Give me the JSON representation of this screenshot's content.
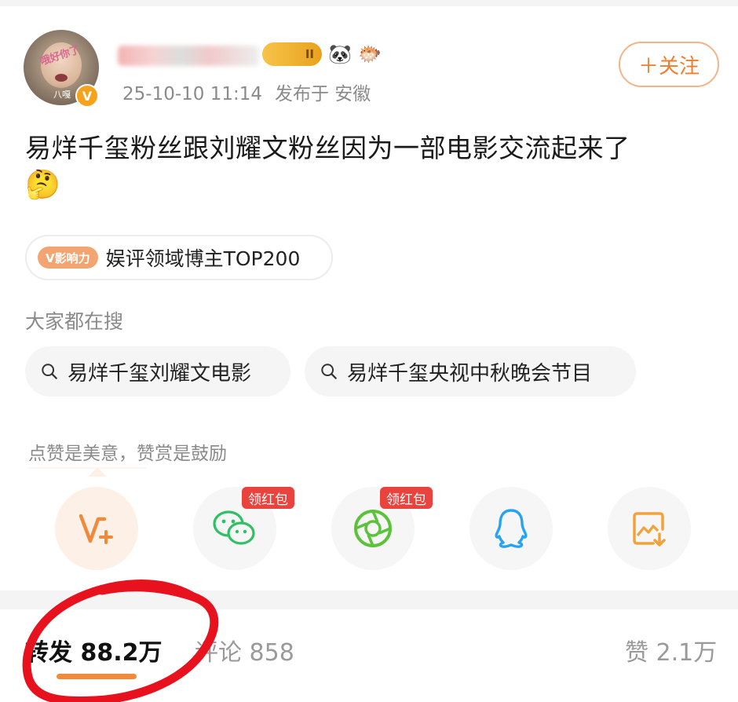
{
  "header": {
    "avatar_caption": "八嘎",
    "avatar_sticker": "哦好你了",
    "verified_mark": "V",
    "level_badge": "II",
    "timestamp": "25-10-10 11:14",
    "location": "发布于 安徽",
    "follow_label": "＋关注"
  },
  "post": {
    "text": "易烊千玺粉丝跟刘耀文粉丝因为一部电影交流起来了",
    "emoji": "🤔",
    "influence_tag": "V影响力",
    "influence_text": "娱评领域博主TOP200"
  },
  "searches": {
    "title": "大家都在搜",
    "items": [
      {
        "label": "易烊千玺刘耀文电影"
      },
      {
        "label": "易烊千玺央视中秋晚会节目"
      }
    ]
  },
  "reward": {
    "text": "点赞是美意，赞赏是鼓励"
  },
  "share": {
    "items": [
      {
        "icon": "weibo-reward-icon"
      },
      {
        "icon": "wechat-icon",
        "badge": "领红包"
      },
      {
        "icon": "moments-icon",
        "badge": "领红包"
      },
      {
        "icon": "qq-icon"
      },
      {
        "icon": "save-image-icon"
      }
    ]
  },
  "tabs": {
    "repost": "转发 88.2万",
    "comment": "评论 858",
    "like": "赞 2.1万"
  },
  "colors": {
    "accent": "#ef7d2c",
    "red": "#e8433d",
    "annotation": "#e8121f"
  }
}
